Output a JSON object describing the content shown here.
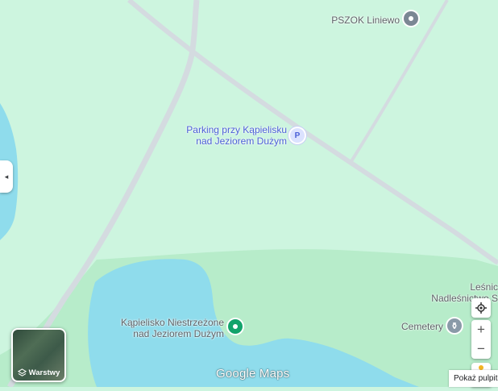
{
  "map": {
    "places": [
      {
        "name": "PSZOK Liniewo",
        "icon": "pin-icon"
      },
      {
        "name_line1": "Parking przy Kąpielisku",
        "name_line2": "nad Jeziorem Dużym",
        "icon": "parking-icon",
        "icon_text": "P"
      },
      {
        "name_line1": "Kąpielisko Niestrzeżone",
        "name_line2": "nad Jeziorem Dużym",
        "icon": "swimming-pin-icon"
      },
      {
        "name": "Cemetery",
        "icon": "cemetery-icon"
      },
      {
        "name_line1": "Leśnic",
        "name_line2": "Nadleśnictwo S"
      }
    ],
    "colors": {
      "land": "#cdf5df",
      "forest": "#b7ecca",
      "water": "#8fdcec",
      "road": "#d4dbe0"
    }
  },
  "controls": {
    "collapse_icon": "◂",
    "layers_label": "Warstwy",
    "logo_text": "Google Maps",
    "zoom_in": "+",
    "zoom_out": "−",
    "locate_icon": "crosshair-icon",
    "show_desktop": "Pokaż pulpit"
  }
}
